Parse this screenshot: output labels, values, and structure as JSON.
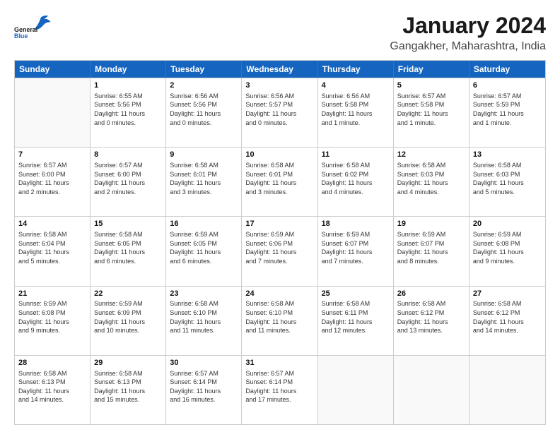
{
  "header": {
    "logo_general": "General",
    "logo_blue": "Blue",
    "title": "January 2024",
    "location": "Gangakher, Maharashtra, India"
  },
  "days_of_week": [
    "Sunday",
    "Monday",
    "Tuesday",
    "Wednesday",
    "Thursday",
    "Friday",
    "Saturday"
  ],
  "weeks": [
    [
      {
        "day": "",
        "info": ""
      },
      {
        "day": "1",
        "info": "Sunrise: 6:55 AM\nSunset: 5:56 PM\nDaylight: 11 hours\nand 0 minutes."
      },
      {
        "day": "2",
        "info": "Sunrise: 6:56 AM\nSunset: 5:56 PM\nDaylight: 11 hours\nand 0 minutes."
      },
      {
        "day": "3",
        "info": "Sunrise: 6:56 AM\nSunset: 5:57 PM\nDaylight: 11 hours\nand 0 minutes."
      },
      {
        "day": "4",
        "info": "Sunrise: 6:56 AM\nSunset: 5:58 PM\nDaylight: 11 hours\nand 1 minute."
      },
      {
        "day": "5",
        "info": "Sunrise: 6:57 AM\nSunset: 5:58 PM\nDaylight: 11 hours\nand 1 minute."
      },
      {
        "day": "6",
        "info": "Sunrise: 6:57 AM\nSunset: 5:59 PM\nDaylight: 11 hours\nand 1 minute."
      }
    ],
    [
      {
        "day": "7",
        "info": "Sunrise: 6:57 AM\nSunset: 6:00 PM\nDaylight: 11 hours\nand 2 minutes."
      },
      {
        "day": "8",
        "info": "Sunrise: 6:57 AM\nSunset: 6:00 PM\nDaylight: 11 hours\nand 2 minutes."
      },
      {
        "day": "9",
        "info": "Sunrise: 6:58 AM\nSunset: 6:01 PM\nDaylight: 11 hours\nand 3 minutes."
      },
      {
        "day": "10",
        "info": "Sunrise: 6:58 AM\nSunset: 6:01 PM\nDaylight: 11 hours\nand 3 minutes."
      },
      {
        "day": "11",
        "info": "Sunrise: 6:58 AM\nSunset: 6:02 PM\nDaylight: 11 hours\nand 4 minutes."
      },
      {
        "day": "12",
        "info": "Sunrise: 6:58 AM\nSunset: 6:03 PM\nDaylight: 11 hours\nand 4 minutes."
      },
      {
        "day": "13",
        "info": "Sunrise: 6:58 AM\nSunset: 6:03 PM\nDaylight: 11 hours\nand 5 minutes."
      }
    ],
    [
      {
        "day": "14",
        "info": "Sunrise: 6:58 AM\nSunset: 6:04 PM\nDaylight: 11 hours\nand 5 minutes."
      },
      {
        "day": "15",
        "info": "Sunrise: 6:58 AM\nSunset: 6:05 PM\nDaylight: 11 hours\nand 6 minutes."
      },
      {
        "day": "16",
        "info": "Sunrise: 6:59 AM\nSunset: 6:05 PM\nDaylight: 11 hours\nand 6 minutes."
      },
      {
        "day": "17",
        "info": "Sunrise: 6:59 AM\nSunset: 6:06 PM\nDaylight: 11 hours\nand 7 minutes."
      },
      {
        "day": "18",
        "info": "Sunrise: 6:59 AM\nSunset: 6:07 PM\nDaylight: 11 hours\nand 7 minutes."
      },
      {
        "day": "19",
        "info": "Sunrise: 6:59 AM\nSunset: 6:07 PM\nDaylight: 11 hours\nand 8 minutes."
      },
      {
        "day": "20",
        "info": "Sunrise: 6:59 AM\nSunset: 6:08 PM\nDaylight: 11 hours\nand 9 minutes."
      }
    ],
    [
      {
        "day": "21",
        "info": "Sunrise: 6:59 AM\nSunset: 6:08 PM\nDaylight: 11 hours\nand 9 minutes."
      },
      {
        "day": "22",
        "info": "Sunrise: 6:59 AM\nSunset: 6:09 PM\nDaylight: 11 hours\nand 10 minutes."
      },
      {
        "day": "23",
        "info": "Sunrise: 6:58 AM\nSunset: 6:10 PM\nDaylight: 11 hours\nand 11 minutes."
      },
      {
        "day": "24",
        "info": "Sunrise: 6:58 AM\nSunset: 6:10 PM\nDaylight: 11 hours\nand 11 minutes."
      },
      {
        "day": "25",
        "info": "Sunrise: 6:58 AM\nSunset: 6:11 PM\nDaylight: 11 hours\nand 12 minutes."
      },
      {
        "day": "26",
        "info": "Sunrise: 6:58 AM\nSunset: 6:12 PM\nDaylight: 11 hours\nand 13 minutes."
      },
      {
        "day": "27",
        "info": "Sunrise: 6:58 AM\nSunset: 6:12 PM\nDaylight: 11 hours\nand 14 minutes."
      }
    ],
    [
      {
        "day": "28",
        "info": "Sunrise: 6:58 AM\nSunset: 6:13 PM\nDaylight: 11 hours\nand 14 minutes."
      },
      {
        "day": "29",
        "info": "Sunrise: 6:58 AM\nSunset: 6:13 PM\nDaylight: 11 hours\nand 15 minutes."
      },
      {
        "day": "30",
        "info": "Sunrise: 6:57 AM\nSunset: 6:14 PM\nDaylight: 11 hours\nand 16 minutes."
      },
      {
        "day": "31",
        "info": "Sunrise: 6:57 AM\nSunset: 6:14 PM\nDaylight: 11 hours\nand 17 minutes."
      },
      {
        "day": "",
        "info": ""
      },
      {
        "day": "",
        "info": ""
      },
      {
        "day": "",
        "info": ""
      }
    ]
  ]
}
